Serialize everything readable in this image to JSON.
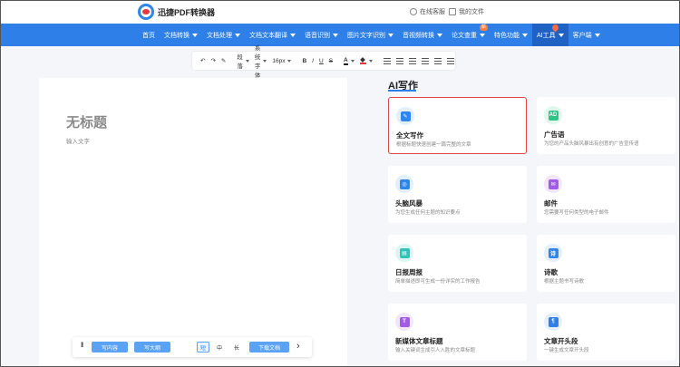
{
  "header": {
    "logo_text": "迅捷PDF转换器",
    "online_service": "在线客服",
    "my_files": "我的文件"
  },
  "nav": {
    "items": [
      {
        "label": "首页",
        "caret": false
      },
      {
        "label": "文档转换",
        "caret": true
      },
      {
        "label": "文档处理",
        "caret": true
      },
      {
        "label": "文档文本翻译",
        "caret": true
      },
      {
        "label": "语音识别",
        "caret": true
      },
      {
        "label": "图片文字识别",
        "caret": true
      },
      {
        "label": "音视频转换",
        "caret": true
      },
      {
        "label": "论文查重",
        "caret": true,
        "badge": "新"
      },
      {
        "label": "特色功能",
        "caret": true
      },
      {
        "label": "AI工具",
        "caret": true,
        "active": true
      },
      {
        "label": "客户端",
        "caret": true
      }
    ]
  },
  "toolbar": {
    "undo": "↶",
    "redo": "↷",
    "brush": "✎",
    "paragraph": "段落",
    "font": "系统字体",
    "size": "16px",
    "bold": "B",
    "italic": "I",
    "underline": "U",
    "strike": "S",
    "color": "A"
  },
  "editor": {
    "title": "无标题",
    "placeholder": "输入文字"
  },
  "bottom_bar": {
    "write_content": "写内容",
    "write_outline": "写大纲",
    "short": "短",
    "medium": "中",
    "long": "长",
    "download": "下载文档",
    "next": "›"
  },
  "ai_panel": {
    "title": "AI写作",
    "cards": [
      {
        "title": "全文写作",
        "desc": "根据标题快速创建一篇完整的文章",
        "icon": "document-edit-icon",
        "icon_text": "✎",
        "color": "#2f86f0",
        "bg": "#e3effd",
        "selected": true
      },
      {
        "title": "广告语",
        "desc": "为您的产品头脑风暴出有创意的广告宣传语",
        "icon": "ad-icon",
        "icon_text": "AD",
        "color": "#2ec486",
        "bg": "#e0f7ec",
        "selected": false
      },
      {
        "title": "头脑风暴",
        "desc": "为您生成任何主题的知识要点",
        "icon": "brainstorm-icon",
        "icon_text": "◎",
        "color": "#2f86f0",
        "bg": "#e3effd",
        "selected": false
      },
      {
        "title": "邮件",
        "desc": "您需要写任何类型的电子邮件",
        "icon": "mail-icon",
        "icon_text": "✉",
        "color": "#a25be8",
        "bg": "#f1e6fd",
        "selected": false
      },
      {
        "title": "日报周报",
        "desc": "简单描述即可生成一份详实的工作报告",
        "icon": "report-icon",
        "icon_text": "▤",
        "color": "#2ec4b8",
        "bg": "#def6f3",
        "selected": false
      },
      {
        "title": "诗歌",
        "desc": "根据主题书写诗歌",
        "icon": "poem-icon",
        "icon_text": "诗",
        "color": "#2f86f0",
        "bg": "#e3effd",
        "selected": false
      },
      {
        "title": "新媒体文章标题",
        "desc": "输入关键词生成引人入胜的文章标题",
        "icon": "headline-icon",
        "icon_text": "T",
        "color": "#a25be8",
        "bg": "#f1e6fd",
        "selected": false
      },
      {
        "title": "文章开头段",
        "desc": "一键生成文章开头段",
        "icon": "paragraph-icon",
        "icon_text": "¶",
        "color": "#2f7fe8",
        "bg": "#e3effd",
        "selected": false
      }
    ]
  }
}
